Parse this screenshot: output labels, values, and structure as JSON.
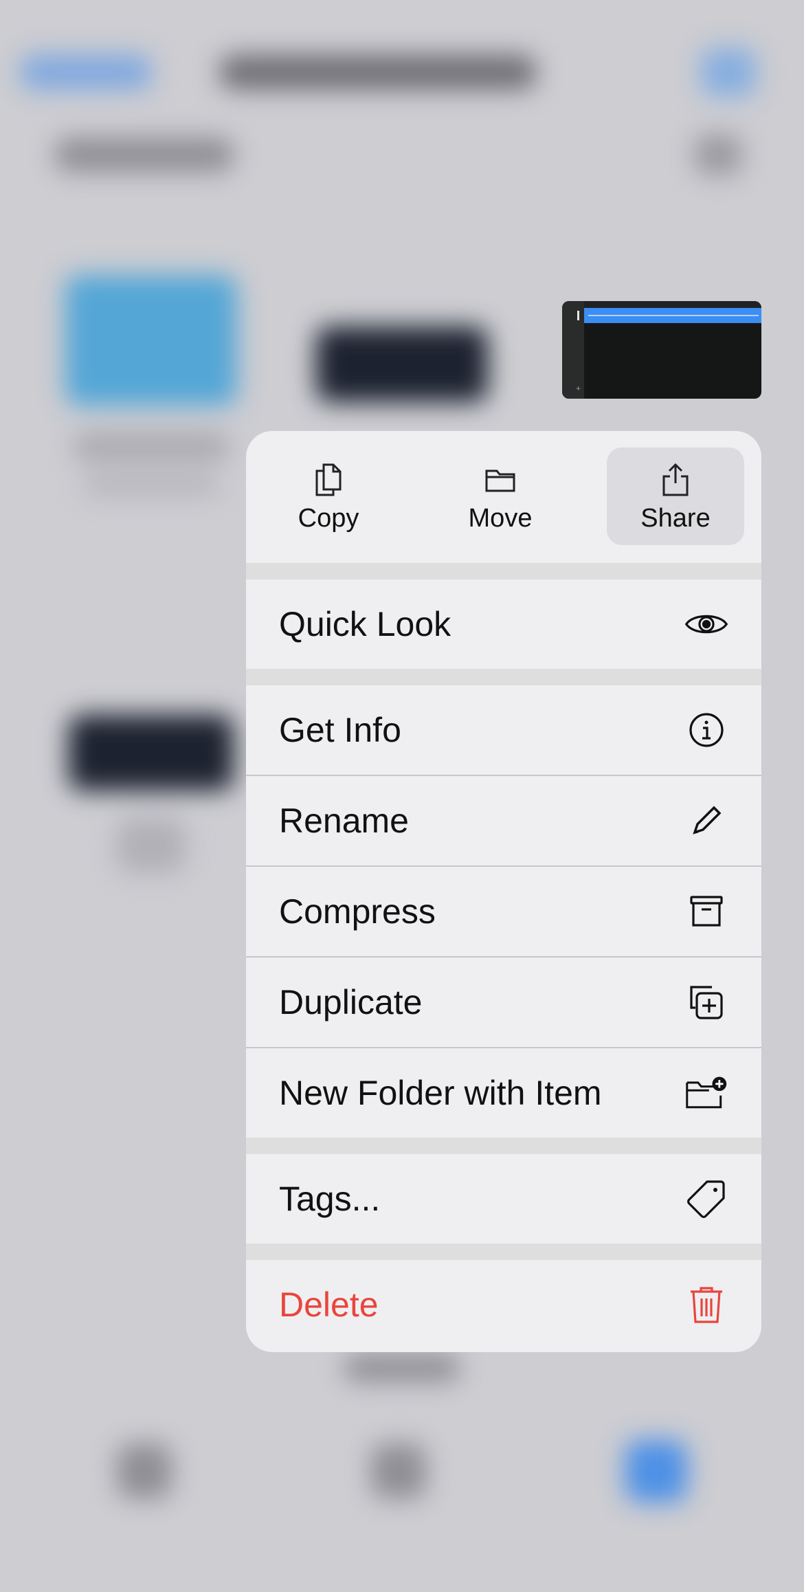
{
  "menu": {
    "actions": {
      "copy": "Copy",
      "move": "Move",
      "share": "Share"
    },
    "items": [
      {
        "label": "Quick Look",
        "icon": "eye-icon"
      },
      {
        "label": "Get Info",
        "icon": "info-icon"
      },
      {
        "label": "Rename",
        "icon": "pencil-icon"
      },
      {
        "label": "Compress",
        "icon": "archive-box-icon"
      },
      {
        "label": "Duplicate",
        "icon": "duplicate-plus-icon"
      },
      {
        "label": "New Folder with Item",
        "icon": "folder-plus-icon"
      },
      {
        "label": "Tags...",
        "icon": "tag-icon"
      },
      {
        "label": "Delete",
        "icon": "trash-icon",
        "destructive": true
      }
    ]
  },
  "colors": {
    "destructive": "#e8453c",
    "menu_background": "#efeff1",
    "highlight": "#dcdce0"
  }
}
